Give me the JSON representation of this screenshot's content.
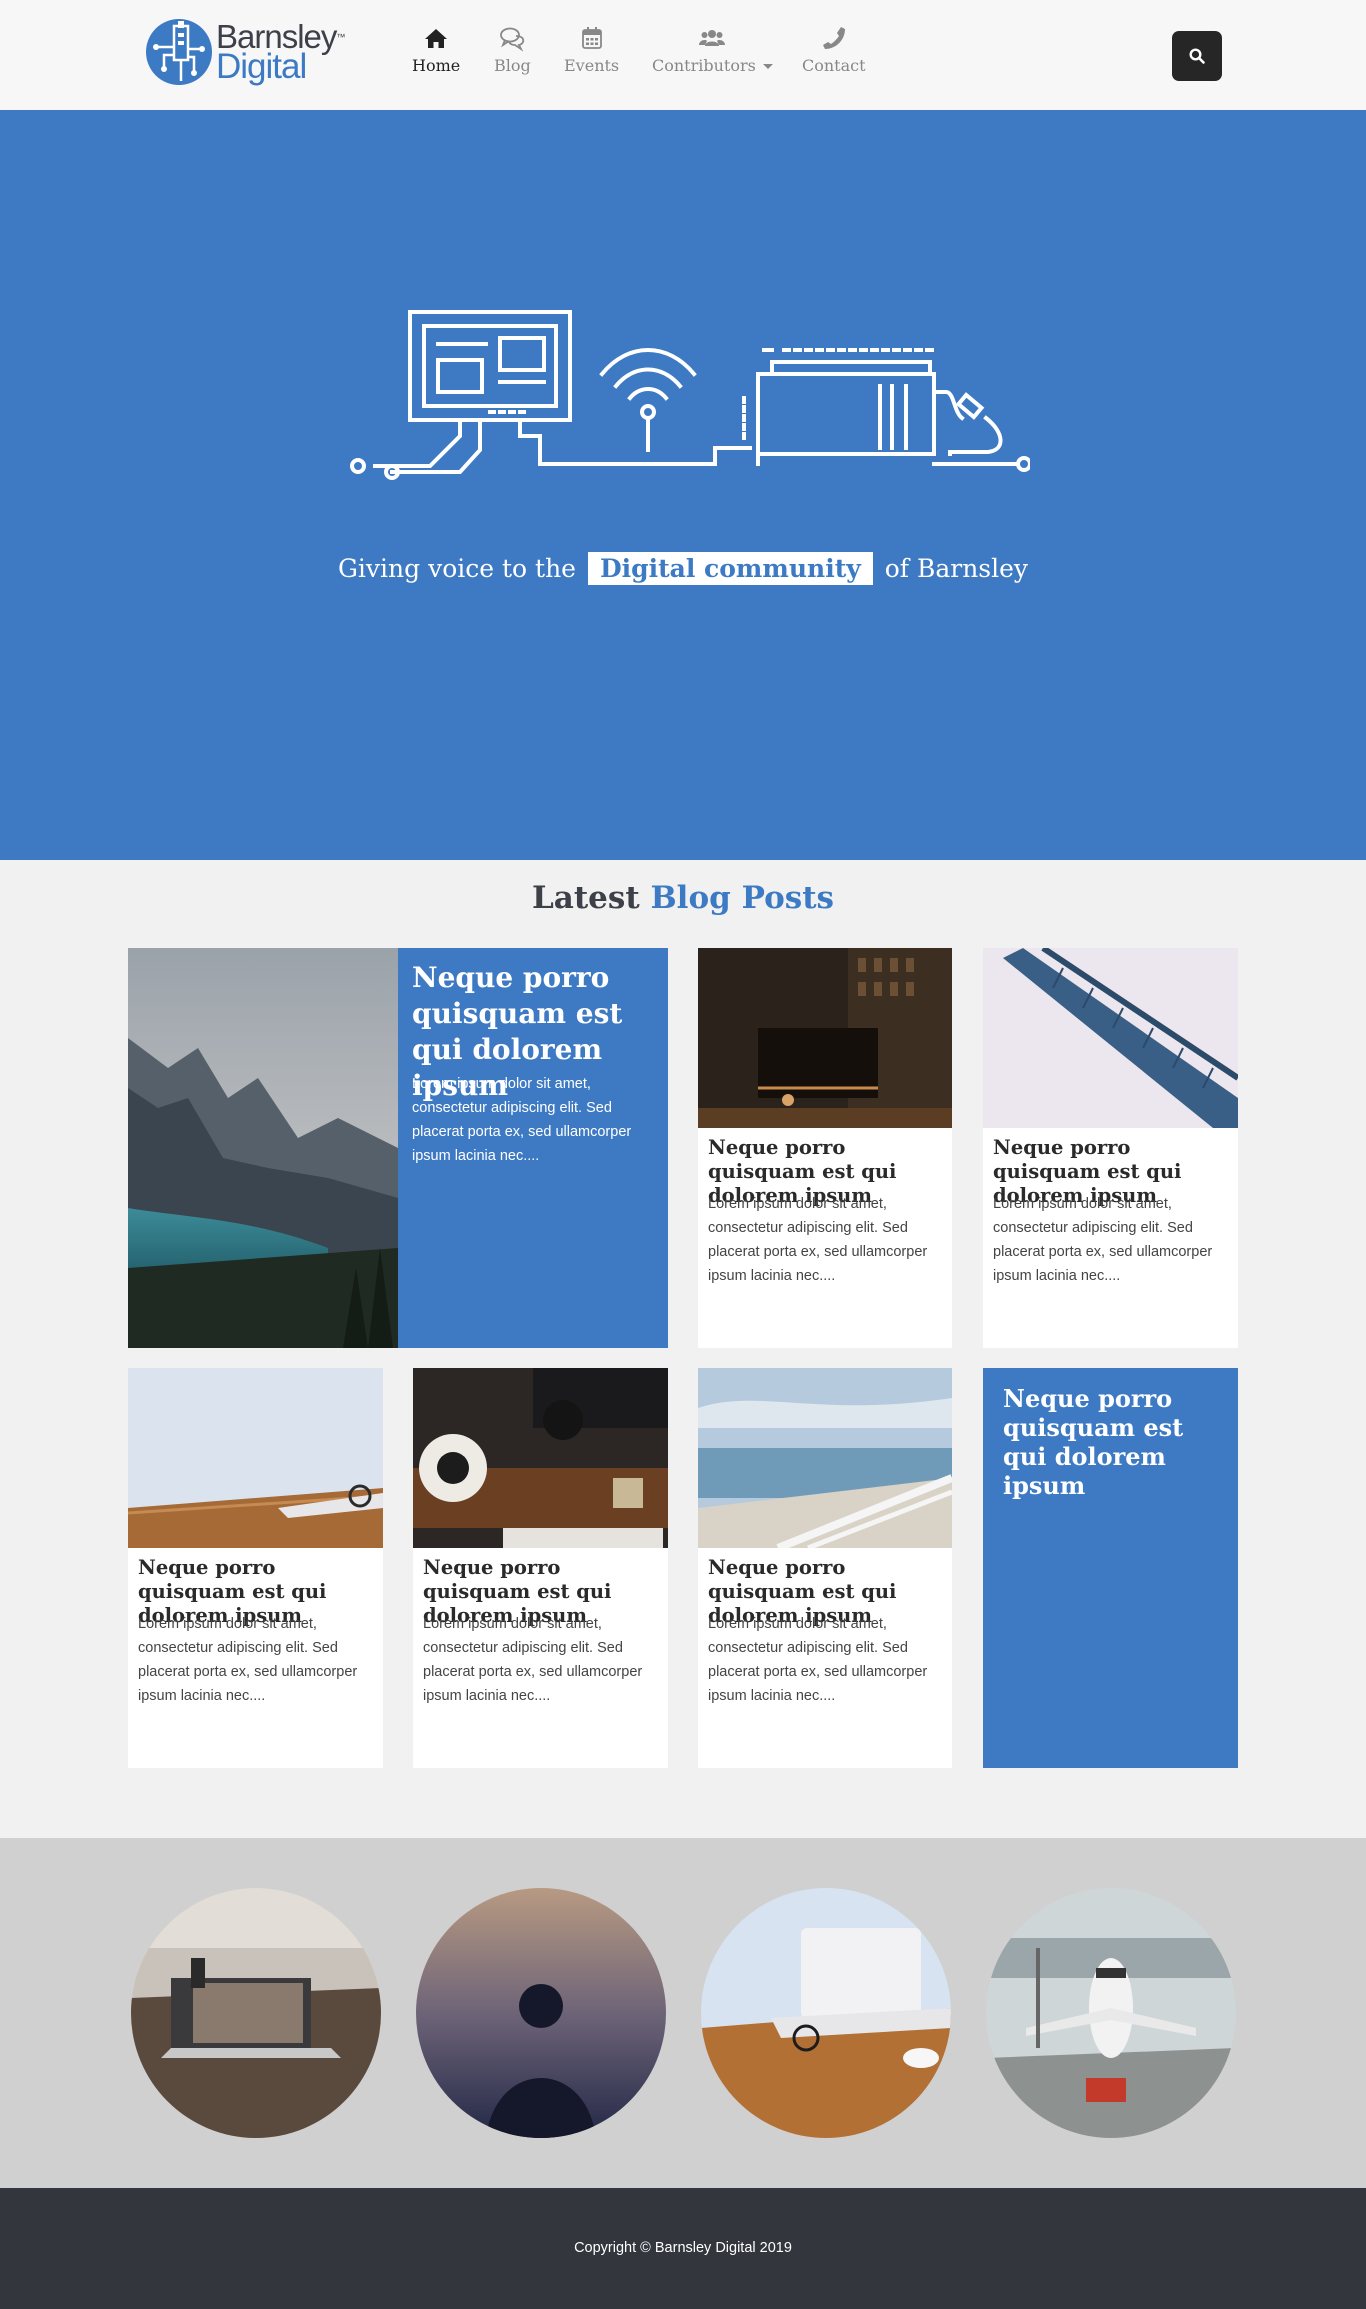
{
  "brand": {
    "line1": "Barnsley",
    "line2": "Digital",
    "tm": "™"
  },
  "nav": [
    {
      "label": "Home",
      "icon": "home-icon",
      "active": true
    },
    {
      "label": "Blog",
      "icon": "comments-icon"
    },
    {
      "label": "Events",
      "icon": "calendar-icon"
    },
    {
      "label": "Contributors",
      "icon": "users-icon",
      "dropdown": true
    },
    {
      "label": "Contact",
      "icon": "phone-icon"
    }
  ],
  "search": {
    "icon": "search-icon"
  },
  "hero": {
    "tagline_before": "Giving voice to the",
    "tagline_highlight": "Digital community",
    "tagline_after": "of Barnsley"
  },
  "blog": {
    "heading_plain": "Latest",
    "heading_accent": "Blog Posts",
    "featured": {
      "title": "Neque porro quisquam est qui dolorem ipsum",
      "excerpt": "Lorem ipsum dolor sit amet, consectetur adipiscing elit. Sed placerat porta ex, sed ullamcorper ipsum lacinia nec...."
    },
    "posts": [
      {
        "title": "Neque porro quisquam est qui dolorem ipsum",
        "excerpt": "Lorem ipsum dolor sit amet, consectetur adipiscing elit. Sed placerat porta ex, sed ullamcorper ipsum lacinia nec...."
      },
      {
        "title": "Neque porro quisquam est qui dolorem ipsum",
        "excerpt": "Lorem ipsum dolor sit amet, consectetur adipiscing elit. Sed placerat porta ex, sed ullamcorper ipsum lacinia nec...."
      },
      {
        "title": "Neque porro quisquam est qui dolorem ipsum",
        "excerpt": "Lorem ipsum dolor sit amet, consectetur adipiscing elit. Sed placerat porta ex, sed ullamcorper ipsum lacinia nec...."
      },
      {
        "title": "Neque porro quisquam est qui dolorem ipsum",
        "excerpt": "Lorem ipsum dolor sit amet, consectetur adipiscing elit. Sed placerat porta ex, sed ullamcorper ipsum lacinia nec...."
      },
      {
        "title": "Neque porro quisquam est qui dolorem ipsum",
        "excerpt": "Lorem ipsum dolor sit amet, consectetur adipiscing elit. Sed placerat porta ex, sed ullamcorper ipsum lacinia nec...."
      }
    ],
    "blue_post": {
      "title": "Neque porro quisquam est qui dolorem ipsum"
    }
  },
  "footer": {
    "copyright": "Copyright © Barnsley Digital 2019"
  },
  "colors": {
    "brand_blue": "#3d7ac3",
    "dark": "#33363d",
    "nav_muted": "#888888"
  }
}
